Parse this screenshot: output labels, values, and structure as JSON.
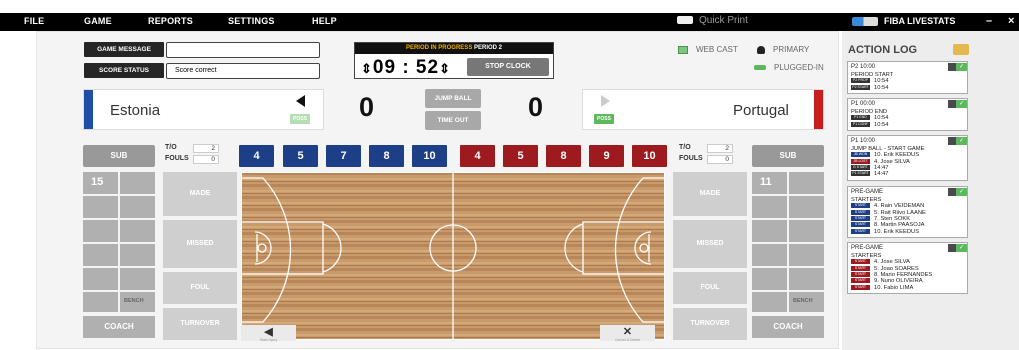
{
  "menu": {
    "file": "FILE",
    "game": "GAME",
    "reports": "REPORTS",
    "settings": "SETTINGS",
    "help": "HELP",
    "quick_print": "Quick Print",
    "brand": "FIBA LIVESTATS",
    "minimize": "–",
    "close": "×"
  },
  "game_message": {
    "label": "GAME MESSAGE",
    "value": ""
  },
  "score_status": {
    "label": "SCORE STATUS",
    "value": "Score correct"
  },
  "period": {
    "label": "PERIOD IN PROGRESS",
    "period": "PERIOD 2",
    "clock": "09 : 52",
    "stop": "STOP CLOCK"
  },
  "status": {
    "webcast": "WEB CAST",
    "primary": "PRIMARY",
    "plugged": "PLUGGED-IN"
  },
  "home": {
    "name": "Estonia",
    "score": "0",
    "to": "2",
    "fouls": "0",
    "players": [
      "4",
      "5",
      "7",
      "8",
      "10"
    ],
    "bench_num": "15"
  },
  "away": {
    "name": "Portugal",
    "score": "0",
    "to": "2",
    "fouls": "0",
    "players": [
      "4",
      "5",
      "8",
      "9",
      "10"
    ],
    "bench_num": "11"
  },
  "labels": {
    "poss": "POSS",
    "jump": "JUMP BALL",
    "timeout": "TIME OUT",
    "sub": "SUB",
    "to": "T/O",
    "fouls": "FOULS",
    "bench": "BENCH",
    "coach": "COACH",
    "made": "MADE",
    "missed": "MISSED",
    "foul": "FOUL",
    "turnover": "TURNOVER",
    "left_small": "Stats Injury",
    "right_small": "Cancel & Delete"
  },
  "log": {
    "title": "ACTION LOG",
    "cards": [
      {
        "h": "P2  10:00",
        "lines": [
          {
            "t": "PERIOD START"
          },
          {
            "tag": "P2 PROP",
            "t": "10:54"
          },
          {
            "tag": "P2 START",
            "t": "10:54"
          }
        ]
      },
      {
        "h": "P1  00:00",
        "lines": [
          {
            "t": "PERIOD END"
          },
          {
            "tag": "P1 END",
            "t": "10:54"
          },
          {
            "tag": "P1 CONF",
            "t": "10:54"
          }
        ]
      },
      {
        "h": "P1  10:00",
        "lines": [
          {
            "t": "JUMP BALL - START GAME"
          },
          {
            "tag": "JB WON",
            "t": "10. Erik KEEDUS",
            "c": "#1d3f87"
          },
          {
            "tag": "JB LOST",
            "t": "4. Jose SILVA",
            "c": "#9d1a1e"
          },
          {
            "tag": "G START",
            "t": "14:47"
          },
          {
            "tag": "P1 START",
            "t": "14:47"
          }
        ]
      },
      {
        "h": "PRE-GAME",
        "lines": [
          {
            "t": "STARTERS"
          },
          {
            "tag": "START",
            "t": "4. Rain VEIDEMAN",
            "c": "#1d3f87"
          },
          {
            "tag": "START",
            "t": "5. Rait Riivo LAANE",
            "c": "#1d3f87"
          },
          {
            "tag": "START",
            "t": "7. Sten SOKK",
            "c": "#1d3f87"
          },
          {
            "tag": "START",
            "t": "8. Martin PAASOJA",
            "c": "#1d3f87"
          },
          {
            "tag": "START",
            "t": "10. Erik KEEDUS",
            "c": "#1d3f87"
          }
        ]
      },
      {
        "h": "PRE-GAME",
        "lines": [
          {
            "t": "STARTERS"
          },
          {
            "tag": "START",
            "t": "4. Jose SILVA",
            "c": "#9d1a1e"
          },
          {
            "tag": "START",
            "t": "5. Joao SOARES",
            "c": "#9d1a1e"
          },
          {
            "tag": "START",
            "t": "8. Mario FERNANDES",
            "c": "#9d1a1e"
          },
          {
            "tag": "START",
            "t": "9. Nuno OLIVEIRA",
            "c": "#9d1a1e"
          },
          {
            "tag": "START",
            "t": "10. Fabio LIMA",
            "c": "#9d1a1e"
          }
        ]
      }
    ]
  }
}
